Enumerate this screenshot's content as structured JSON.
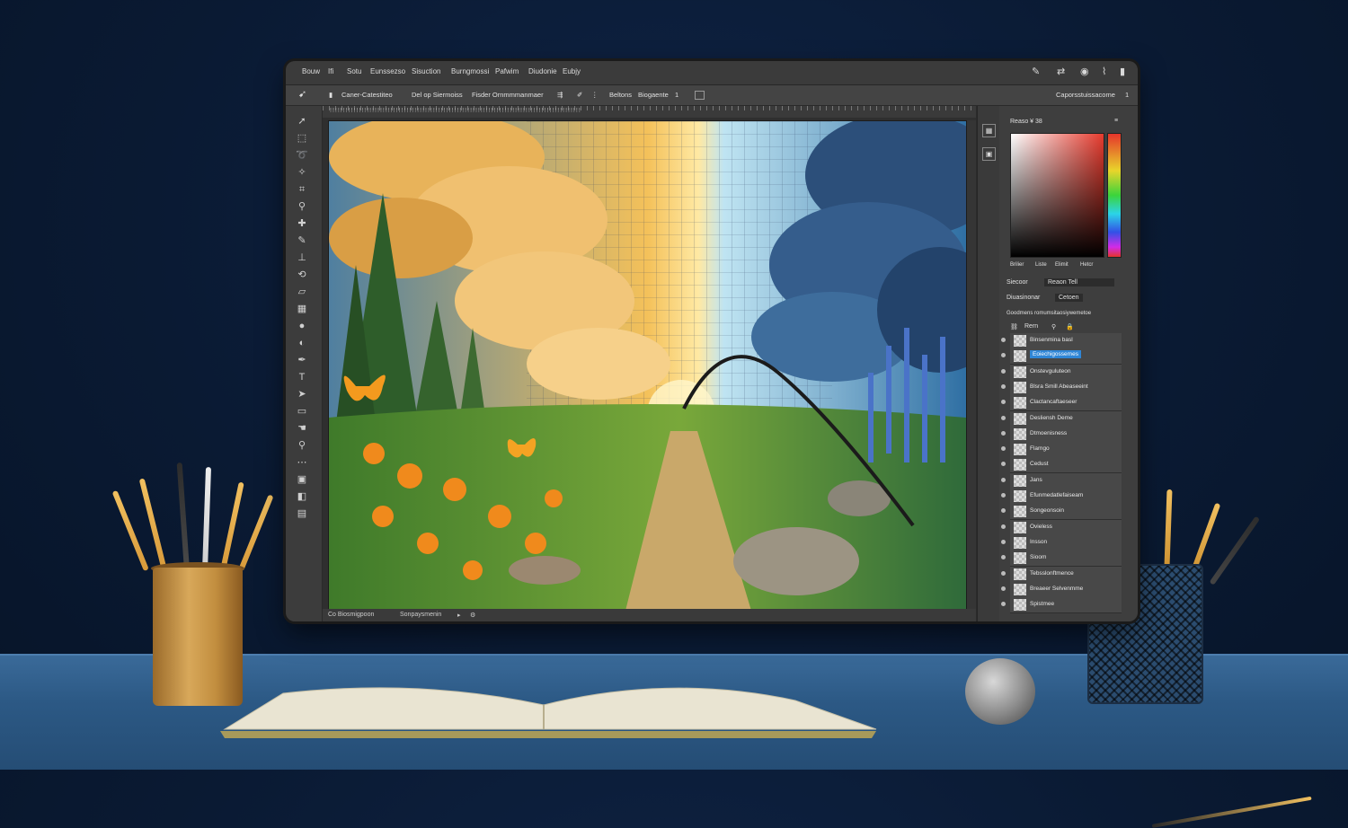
{
  "menubar": {
    "items": [
      "Bouw",
      "Ifi",
      "Sotu",
      "Eunssezso",
      "Sisuction",
      "Burngmossi",
      "Pafwim",
      "Diudonie",
      "Eubjy"
    ],
    "right_label": "Caporsstuissacome",
    "right_value": "1"
  },
  "options": {
    "item1": "Caner-Catestiteo",
    "item2": "Del op Siermoiss",
    "item3": "Fisder Ornmmmanmaer",
    "item4": "Beltons",
    "item5": "Biogaente",
    "item6": "1"
  },
  "ruler": {
    "text": "!!!!!!!!!!!!!!!!!!!!!!!!!!!!!!!!!!!!!!!!!!!!!!!!!!!!!!!!!!!!!!!!!!!!!!!!!!!!!!!!!!!!!!!!!!!!!!!"
  },
  "status": {
    "left": "Co Biosmigpoon",
    "mid": "Sonpaysmenin"
  },
  "panels": {
    "color_title": "Reaso ¥ 38",
    "color_tabs": [
      "Brilier",
      "Liste",
      "Elimit",
      "Hetcr"
    ],
    "swatch_label": "Siecoor",
    "swatch_value": "Reaon Tell",
    "blend_label": "Diuasinonar",
    "blend_value": "Cetoen",
    "layers_title": "Goodmens romumsitaosiywemetoe",
    "layers_toolbar": "Rern",
    "layers": [
      "Binsenmina basl",
      "Eoiechigossemes",
      "Onstevguluteon",
      "Blsra Smill Abeaseeint",
      "Clactancaftaeseer",
      "Desliensh Deme",
      "Dtmoenisness",
      "Flamgo",
      "Cedust",
      "Jans",
      "Efunmedatlefaiseam",
      "Songeonsoin",
      "Ovieless",
      "Insson",
      "Sioom",
      "Tebsslonftmence",
      "Breaeer Selvenmme",
      "Spistmee"
    ]
  },
  "colors": {
    "accent": "#2f86d6",
    "panel_bg": "#3e3e3e",
    "desk": "#2c5985"
  }
}
